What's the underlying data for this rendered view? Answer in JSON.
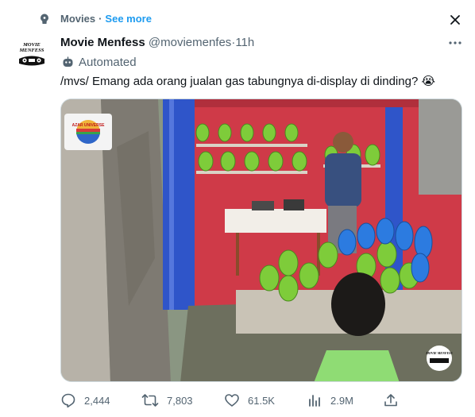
{
  "context": {
    "label": "Movies",
    "link": "See more",
    "separator": "·"
  },
  "author": {
    "name": "Movie Menfess",
    "handle": "@moviemenfes",
    "time": "11h",
    "sep": "·",
    "avatar_text": "MOVIE MENFESS",
    "automated_label": "Automated"
  },
  "tweet": {
    "text": "/mvs/ Emang ada orang jualan gas tabungnya di-display di dinding? 😭"
  },
  "media": {
    "channel_logo_text": "AZAR UNIVERSE",
    "watermark_text": "MOVIE MENFESS"
  },
  "actions": {
    "replies": "2,444",
    "reposts": "7,803",
    "likes": "61.5K",
    "views": "2.9M"
  },
  "colors": {
    "accent": "#1d9bf0",
    "muted": "#536471",
    "text": "#0f1419"
  }
}
